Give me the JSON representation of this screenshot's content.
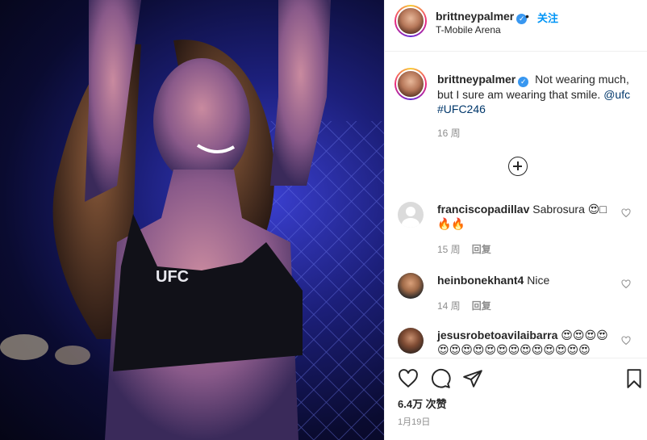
{
  "post": {
    "username": "brittneypalmer",
    "follow_label": "关注",
    "dot": "•",
    "location": "T-Mobile Arena",
    "photo_logo": "UFC"
  },
  "caption": {
    "username": "brittneypalmer",
    "text": "Not wearing much, but I sure am wearing that smile.",
    "mention": "@ufc",
    "hashtag": "#UFC246",
    "time": "16 周"
  },
  "comments": [
    {
      "username": "franciscopadillav",
      "text": "Sabrosura 😍□🔥🔥",
      "time": "15 周",
      "reply": "回复"
    },
    {
      "username": "heinbonekhant4",
      "text": "Nice",
      "time": "14 周",
      "reply": "回复"
    },
    {
      "username": "jesusrobetoavilaibarra",
      "text": "😍😍😍😍😍😍😍😍😍😍😍😍😍😍😍😍😍"
    }
  ],
  "footer": {
    "likes": "6.4万 次赞",
    "date": "1月19日"
  },
  "icons": {
    "verified": "verified-badge-icon",
    "load_more": "plus-circle-icon",
    "like": "heart-icon",
    "comment": "comment-bubble-icon",
    "share": "paper-plane-icon",
    "save": "bookmark-icon"
  },
  "colors": {
    "accent": "#0095f6",
    "verified": "#3897f0",
    "muted": "#8e8e8e"
  }
}
